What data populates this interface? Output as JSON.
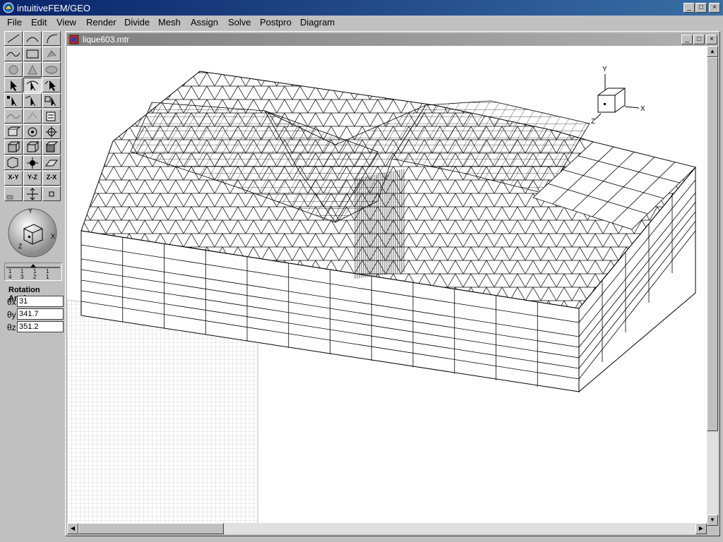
{
  "app": {
    "title": "intuitiveFEM/GEO",
    "window_buttons": [
      "_",
      "□",
      "×"
    ]
  },
  "menu": [
    "File",
    "Edit",
    "View",
    "Render",
    "Divide",
    "Mesh",
    "Assign",
    "Solve",
    "Postpro",
    "Diagram"
  ],
  "toolbox": {
    "tools": [
      "line-tool",
      "arc-tool",
      "arc3-tool",
      "spline-tool",
      "rectangle-tool",
      "sweep-tool",
      "circle-tool",
      "cone-tool",
      "torus-tool",
      "select-tool",
      "rotate-select-tool",
      "select-pick-tool",
      "vertex-select-tool",
      "edge-select-tool",
      "face-select-tool",
      "curve-edit-tool",
      "transform-tool",
      "list-tool",
      "extrude-tool",
      "revolve-tool",
      "move-tool",
      "box-solid-tool",
      "box-wire-tool",
      "box-shade-tool",
      "fit-view-tool",
      "pan-view-tool",
      "plane-tool",
      "view-xy-tool",
      "view-yz-tool",
      "view-zx-tool",
      "grid-toggle-tool",
      "center-tool",
      "point-tool"
    ],
    "view_labels": {
      "xy": "X-Y",
      "yz": "Y-Z",
      "zx": "Z-X"
    },
    "axis_labels": {
      "x": "X",
      "y": "Y",
      "z": "Z"
    },
    "layers": [
      "4",
      "3",
      "2",
      "1"
    ],
    "layer_values": [
      "1",
      "1",
      "1",
      "1"
    ],
    "rotation": {
      "label": "Rotation Angle",
      "theta_x": {
        "symbol": "θx",
        "value": "31"
      },
      "theta_y": {
        "symbol": "θy",
        "value": "341.7"
      },
      "theta_z": {
        "symbol": "θz",
        "value": "351.2"
      }
    }
  },
  "document": {
    "title": "lique603.mtr",
    "window_buttons": [
      "_",
      "□",
      "×"
    ],
    "axis_triad": {
      "x": "X",
      "y": "Y",
      "z": "Z"
    }
  },
  "scrollbars": {
    "up": "▲",
    "down": "▼",
    "left": "◀",
    "right": "▶"
  },
  "colors": {
    "title_active": "#0a246a",
    "title_inactive": "#808080",
    "face": "#c0c0c0",
    "mesh": "#000000",
    "canvas": "#ffffff"
  }
}
